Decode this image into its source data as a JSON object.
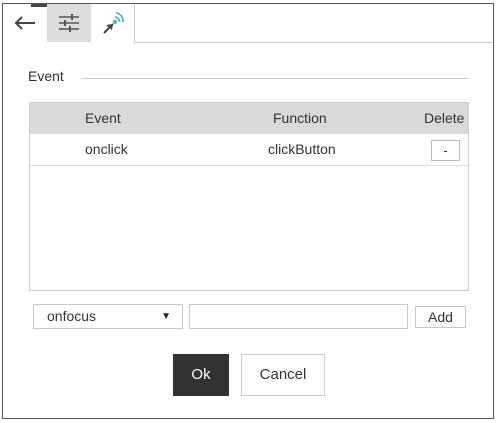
{
  "toolbar": {
    "tabs": [
      {
        "icon": "back-arrow-icon"
      },
      {
        "icon": "sliders-icon",
        "active": true
      },
      {
        "icon": "event-pointer-icon"
      }
    ]
  },
  "section": {
    "legend": "Event"
  },
  "table": {
    "headers": [
      "Event",
      "Function",
      "Delete"
    ],
    "rows": [
      {
        "event": "onclick",
        "function": "clickButton",
        "delete_label": "-"
      }
    ]
  },
  "form": {
    "event_select_value": "onfocus",
    "select_arrow": "▼",
    "function_value": "",
    "add_label": "Add"
  },
  "actions": {
    "ok_label": "Ok",
    "cancel_label": "Cancel"
  },
  "colors": {
    "ok_bg": "#333333",
    "header_bg": "#d9d9d9",
    "active_tab_bg": "#dcdcdc",
    "icon_accent": "#5bb3c9"
  }
}
